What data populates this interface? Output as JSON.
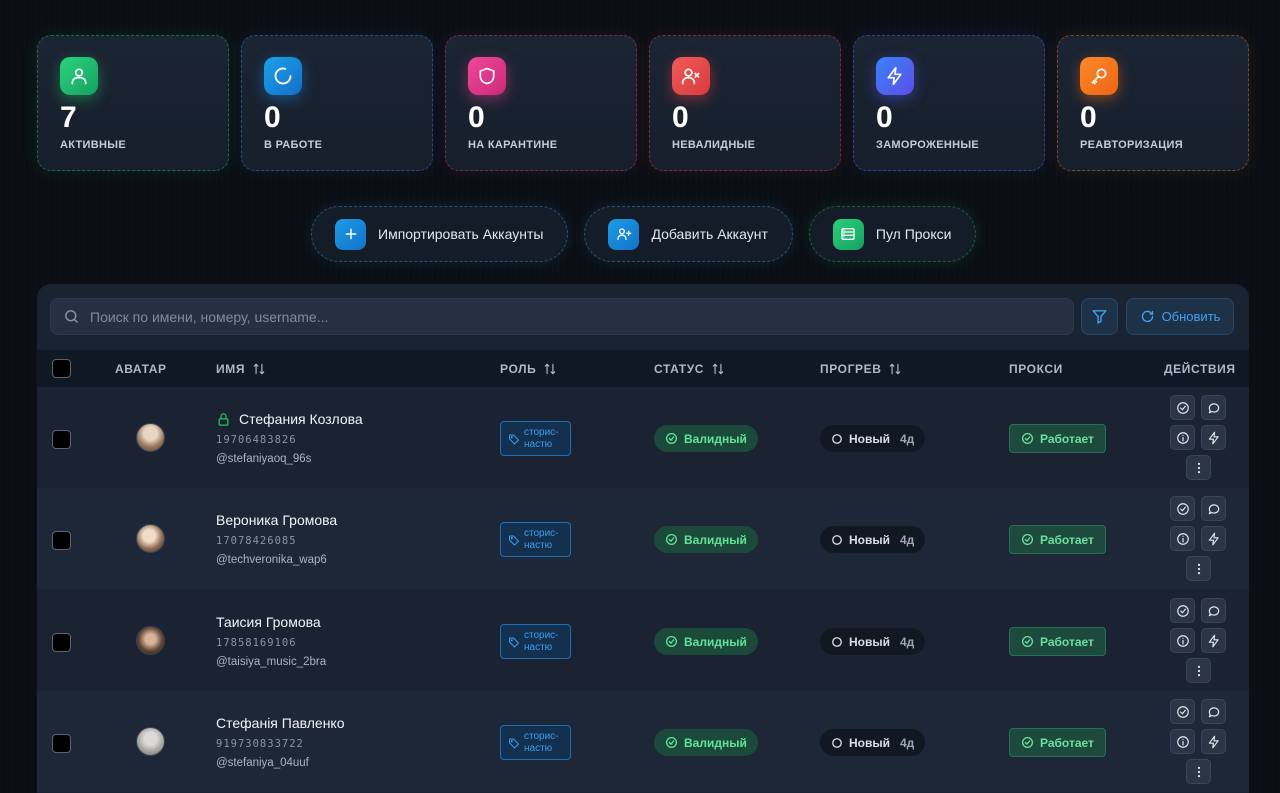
{
  "stats": [
    {
      "value": "7",
      "label": "АКТИВНЫЕ",
      "color": "#22c55e",
      "icon": "user-icon"
    },
    {
      "value": "0",
      "label": "В РАБОТЕ",
      "color": "#1e8ce6",
      "icon": "loader-icon"
    },
    {
      "value": "0",
      "label": "НА КАРАНТИНЕ",
      "color": "#ec4899",
      "icon": "shield-icon"
    },
    {
      "value": "0",
      "label": "НЕВАЛИДНЫЕ",
      "color": "#ef4444",
      "icon": "user-x-icon"
    },
    {
      "value": "0",
      "label": "ЗАМОРОЖЕННЫЕ",
      "color": "#4f5af0",
      "icon": "zap-icon"
    },
    {
      "value": "0",
      "label": "РЕАВТОРИЗАЦИЯ",
      "color": "#f97316",
      "icon": "key-icon"
    }
  ],
  "actions": {
    "import_label": "Импортировать Аккаунты",
    "add_label": "Добавить Аккаунт",
    "proxy_label": "Пул Прокси"
  },
  "search": {
    "placeholder": "Поиск по имени, номеру, username...",
    "refresh_label": "Обновить"
  },
  "table": {
    "headers": {
      "avatar": "АВАТАР",
      "name": "ИМЯ",
      "role": "РОЛЬ",
      "status": "СТАТУС",
      "warmup": "ПРОГРЕВ",
      "proxy": "ПРОКСИ",
      "actions": "ДЕЙСТВИЯ"
    },
    "rows": [
      {
        "name": "Стефания Козлова",
        "phone": "19706483826",
        "username": "@stefaniyaoq_96s",
        "locked": true,
        "role_line1": "сторис-",
        "role_line2": "настю",
        "status": "Валидный",
        "warmup": "Новый",
        "days": "4д",
        "proxy": "Работает"
      },
      {
        "name": "Вероника Громова",
        "phone": "17078426085",
        "username": "@techveronika_wap6",
        "locked": false,
        "role_line1": "сторис-",
        "role_line2": "настю",
        "status": "Валидный",
        "warmup": "Новый",
        "days": "4д",
        "proxy": "Работает"
      },
      {
        "name": "Таисия Громова",
        "phone": "17858169106",
        "username": "@taisiya_music_2bra",
        "locked": false,
        "role_line1": "сторис-",
        "role_line2": "настю",
        "status": "Валидный",
        "warmup": "Новый",
        "days": "4д",
        "proxy": "Работает"
      },
      {
        "name": "Стефанія Павленко",
        "phone": "919730833722",
        "username": "@stefaniya_04uuf",
        "locked": false,
        "role_line1": "сторис-",
        "role_line2": "настю",
        "status": "Валидный",
        "warmup": "Новый",
        "days": "4д",
        "proxy": "Работает"
      }
    ]
  }
}
